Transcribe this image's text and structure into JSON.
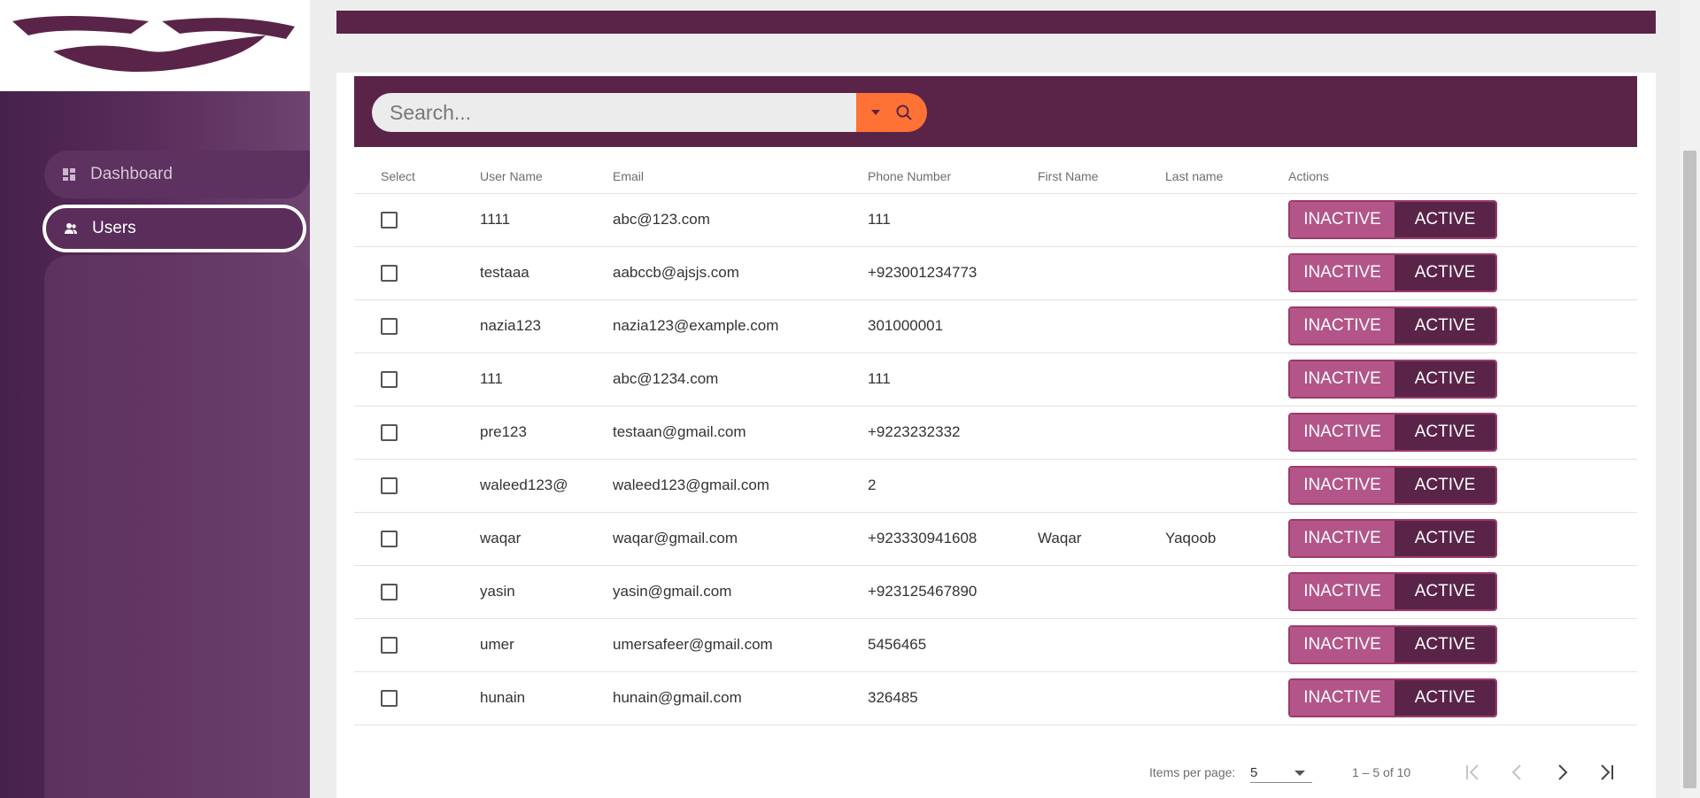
{
  "sidebar": {
    "items": [
      {
        "label": "Dashboard",
        "icon": "dashboard-icon"
      },
      {
        "label": "Users",
        "icon": "users-icon"
      }
    ]
  },
  "search": {
    "placeholder": "Search..."
  },
  "table": {
    "headers": [
      "Select",
      "User Name",
      "Email",
      "Phone Number",
      "First Name",
      "Last name",
      "Actions"
    ],
    "rows": [
      {
        "username": "1111",
        "email": "abc@123.com",
        "phone": "111",
        "first": "",
        "last": ""
      },
      {
        "username": "testaaa",
        "email": "aabccb@ajsjs.com",
        "phone": "+923001234773",
        "first": "",
        "last": ""
      },
      {
        "username": "nazia123",
        "email": "nazia123@example.com",
        "phone": "301000001",
        "first": "",
        "last": ""
      },
      {
        "username": "111",
        "email": "abc@1234.com",
        "phone": "111",
        "first": "",
        "last": ""
      },
      {
        "username": "pre123",
        "email": "testaan@gmail.com",
        "phone": "+9223232332",
        "first": "",
        "last": ""
      },
      {
        "username": "waleed123@",
        "email": "waleed123@gmail.com",
        "phone": "2",
        "first": "",
        "last": ""
      },
      {
        "username": "waqar",
        "email": "waqar@gmail.com",
        "phone": "+923330941608",
        "first": "Waqar",
        "last": "Yaqoob"
      },
      {
        "username": "yasin",
        "email": "yasin@gmail.com",
        "phone": "+923125467890",
        "first": "",
        "last": ""
      },
      {
        "username": "umer",
        "email": "umersafeer@gmail.com",
        "phone": "5456465",
        "first": "",
        "last": ""
      },
      {
        "username": "hunain",
        "email": "hunain@gmail.com",
        "phone": "326485",
        "first": "",
        "last": ""
      }
    ],
    "action_inactive": "INACTIVE",
    "action_active": "ACTIVE"
  },
  "paginator": {
    "items_per_page_label": "Items per page:",
    "page_size": "5",
    "range": "1 – 5 of 10"
  },
  "colors": {
    "brand": "#5a2449",
    "accent": "#ff7235",
    "inactive": "#b35589"
  }
}
